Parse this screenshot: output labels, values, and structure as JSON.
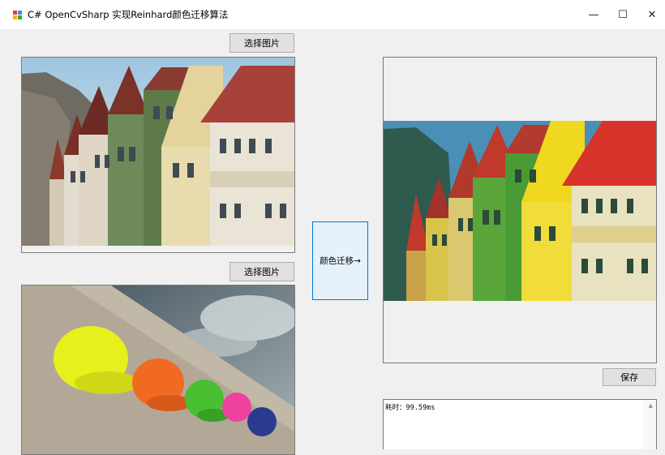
{
  "window": {
    "title": "C# OpenCvSharp 实现Reinhard颜色迁移算法",
    "minimize_glyph": "—",
    "maximize_glyph": "☐",
    "close_glyph": "✕"
  },
  "source_panel": {
    "select_button_label": "选择图片"
  },
  "target_panel": {
    "select_button_label": "选择图片"
  },
  "transfer_button_label": "颜色迁移→",
  "result_panel": {
    "save_button_label": "保存"
  },
  "log": {
    "text": "耗时：99.59ms"
  },
  "icons": {
    "app": "app-icon",
    "scroll_up": "chevron-up-icon"
  },
  "colors": {
    "window_bg": "#f0f0f0",
    "button_bg": "#e1e1e1",
    "accent": "#0078d7",
    "accent_bg": "#e5f1fb"
  }
}
